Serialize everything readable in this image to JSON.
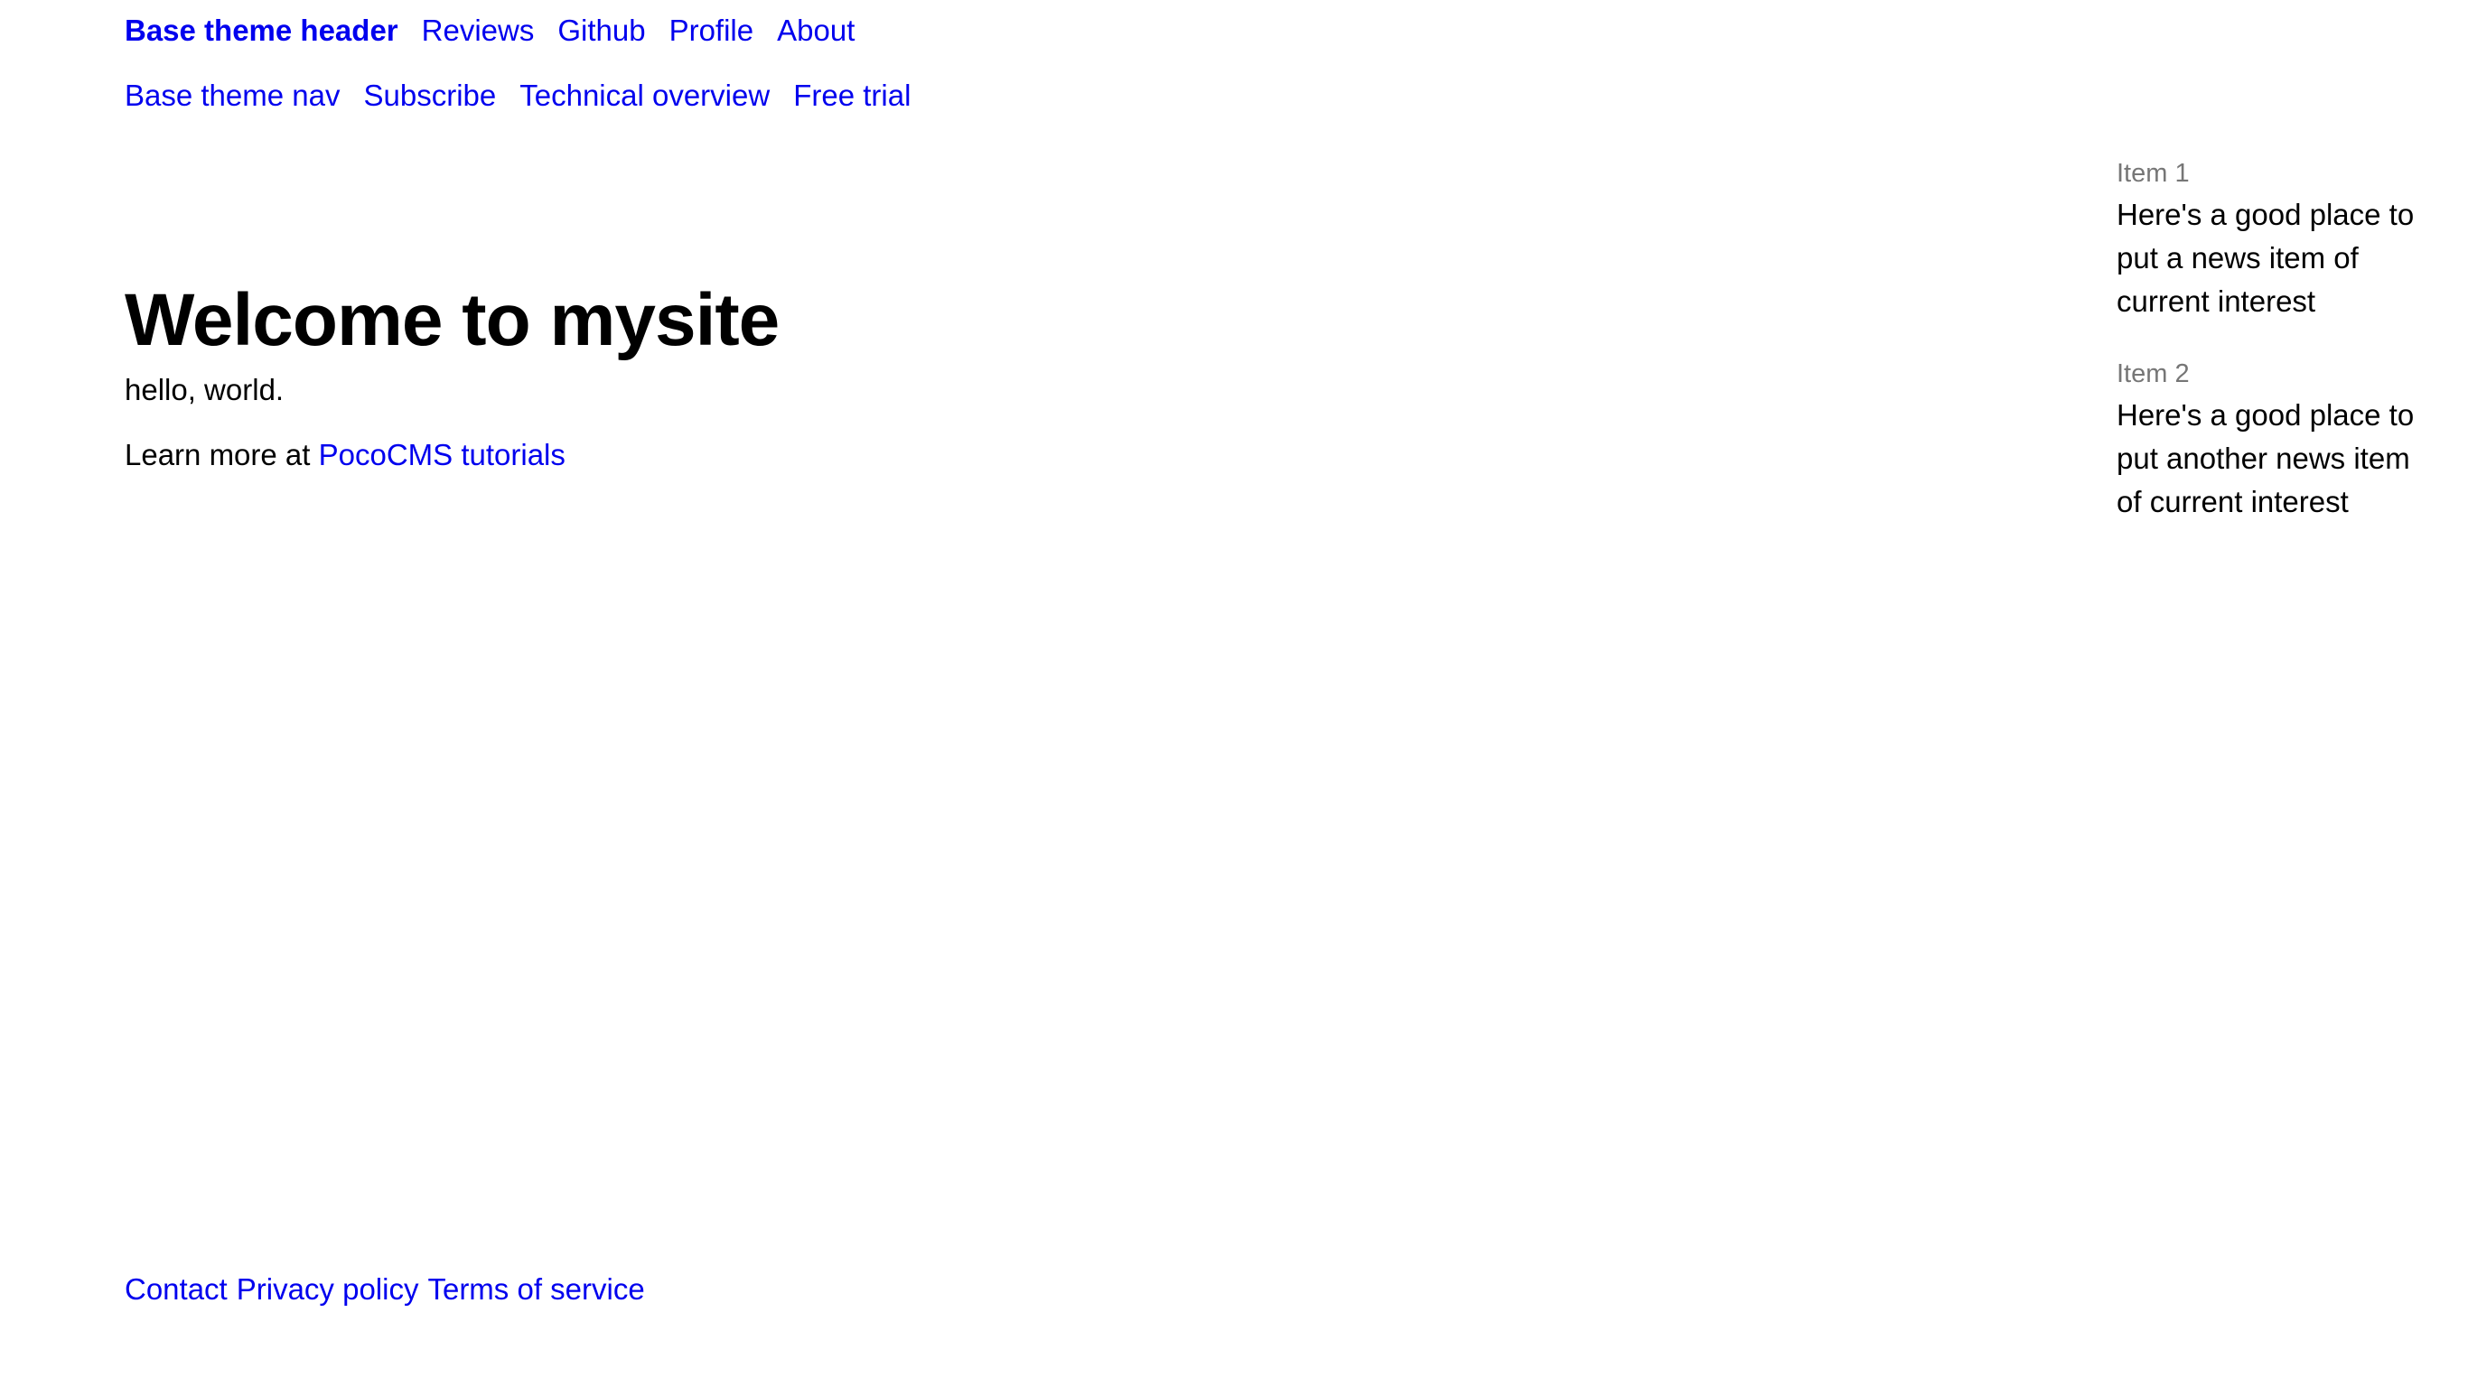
{
  "header": {
    "brand": "Base theme header",
    "links": [
      "Reviews",
      "Github",
      "Profile",
      "About"
    ]
  },
  "nav": {
    "links": [
      "Base theme nav",
      "Subscribe",
      "Technical overview",
      "Free trial"
    ]
  },
  "main": {
    "title": "Welcome to mysite",
    "intro": "hello, world.",
    "learn_prefix": "Learn more at ",
    "learn_link": "PocoCMS tutorials"
  },
  "aside": {
    "items": [
      {
        "label": "Item 1",
        "text": "Here's a good place to put a news item of current interest"
      },
      {
        "label": "Item 2",
        "text": "Here's a good place to put another news item of current interest"
      }
    ]
  },
  "footer": {
    "links": [
      "Contact",
      "Privacy policy",
      "Terms of service"
    ]
  },
  "colors": {
    "link": "#0000ee",
    "text": "#000000",
    "muted": "#767676",
    "background": "#ffffff"
  }
}
